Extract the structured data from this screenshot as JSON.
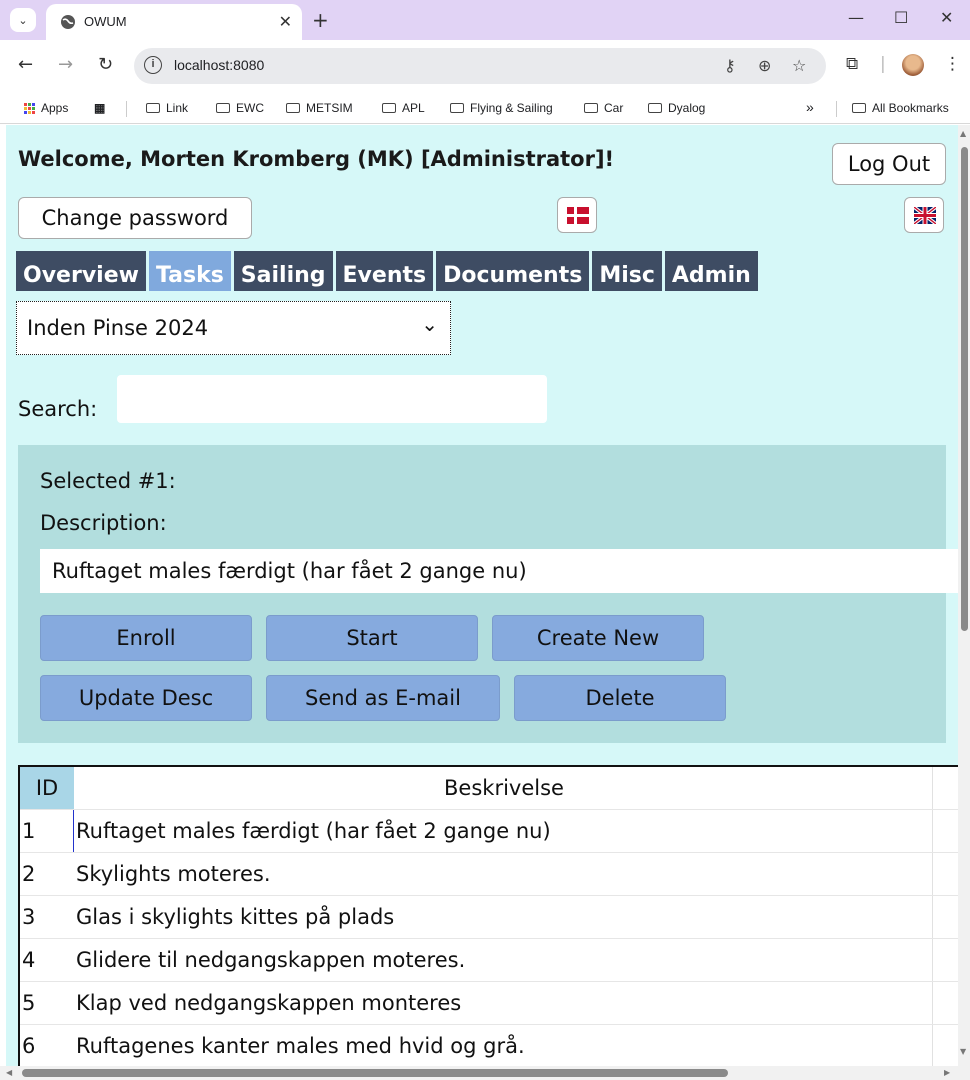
{
  "browser": {
    "tab_title": "OWUM",
    "url": "localhost:8080",
    "bookmarks": [
      "Apps",
      "Link",
      "EWC",
      "METSIM",
      "APL",
      "Flying & Sailing",
      "Car",
      "Dyalog"
    ],
    "all_bookmarks": "All Bookmarks",
    "overflow": "»"
  },
  "app": {
    "welcome": "Welcome, Morten Kromberg (MK) [Administrator]!",
    "logout_label": "Log Out",
    "change_password_label": "Change password",
    "nav_tabs": [
      {
        "label": "Overview",
        "active": false
      },
      {
        "label": "Tasks",
        "active": true
      },
      {
        "label": "Sailing",
        "active": false
      },
      {
        "label": "Events",
        "active": false
      },
      {
        "label": "Documents",
        "active": false
      },
      {
        "label": "Misc",
        "active": false
      },
      {
        "label": "Admin",
        "active": false
      }
    ],
    "selected_period": "Inden Pinse 2024",
    "search_label": "Search:",
    "search_value": "",
    "panel": {
      "selected_label": "Selected #1:",
      "description_label": "Description:",
      "description_value": "Ruftaget males færdigt (har fået 2 gange nu)",
      "buttons": {
        "enroll": "Enroll",
        "start": "Start",
        "create_new": "Create New",
        "update_desc": "Update Desc",
        "send_email": "Send as E-mail",
        "delete": "Delete"
      }
    },
    "table": {
      "headers": {
        "id": "ID",
        "desc": "Beskrivelse"
      },
      "rows": [
        {
          "id": "1",
          "desc": "Ruftaget males færdigt (har fået 2 gange nu)"
        },
        {
          "id": "2",
          "desc": "Skylights moteres."
        },
        {
          "id": "3",
          "desc": "Glas i skylights kittes på plads"
        },
        {
          "id": "4",
          "desc": "Glidere til nedgangskappen moteres."
        },
        {
          "id": "5",
          "desc": "Klap ved nedgangskappen monteres"
        },
        {
          "id": "6",
          "desc": "Ruftagenes kanter males med hvid og grå."
        }
      ]
    }
  }
}
